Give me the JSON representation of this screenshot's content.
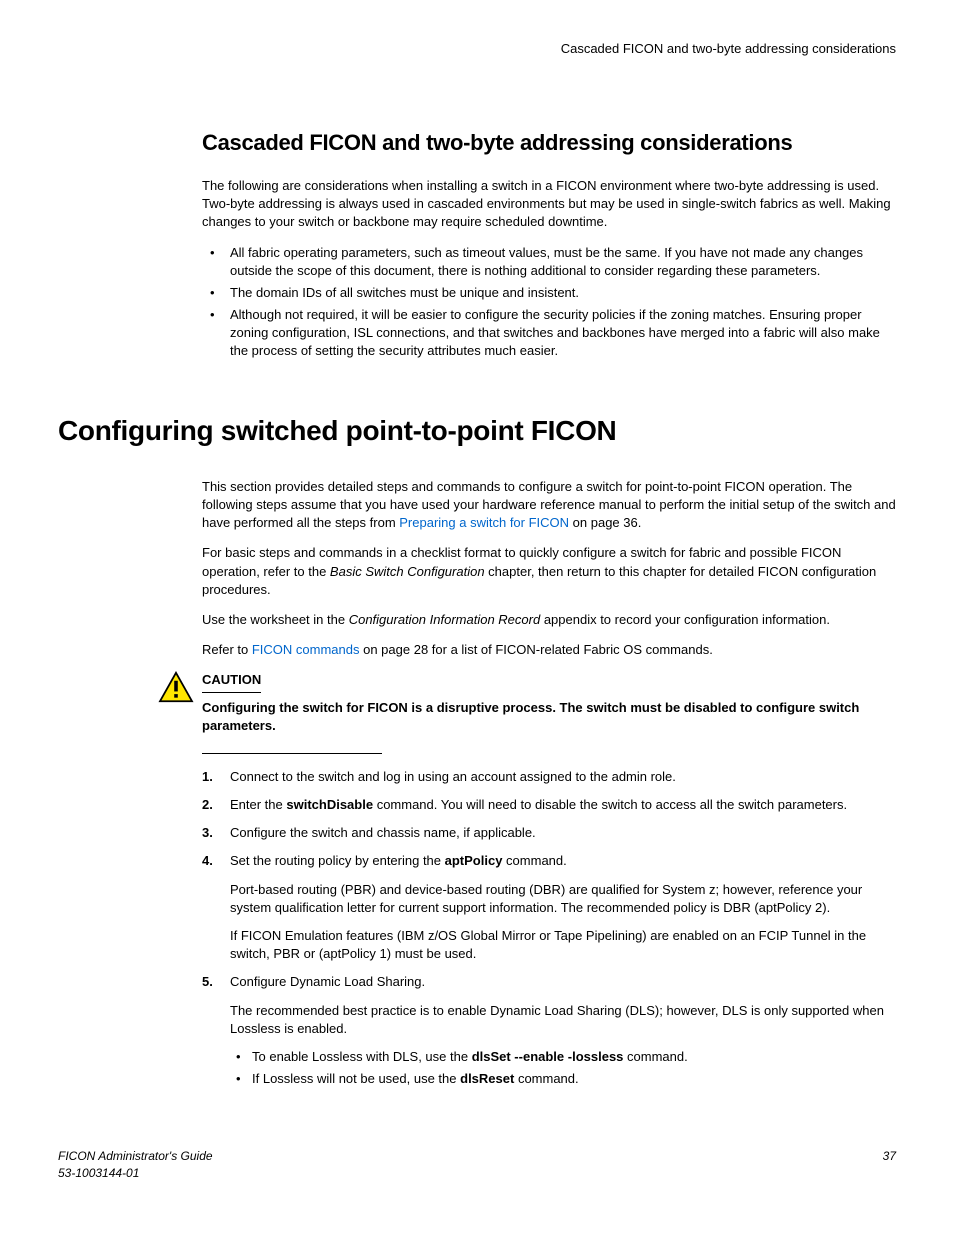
{
  "header": {
    "running": "Cascaded FICON and two-byte addressing considerations"
  },
  "section1": {
    "title": "Cascaded FICON and two-byte addressing considerations",
    "intro": "The following are considerations when installing a switch in a FICON environment where two-byte addressing is used. Two-byte addressing is always used in cascaded environments but may be used in single-switch fabrics as well. Making changes to your switch or backbone may require scheduled downtime.",
    "bullets": [
      "All fabric operating parameters, such as timeout values, must be the same. If you have not made any changes outside the scope of this document, there is nothing additional to consider regarding these parameters.",
      "The domain IDs of all switches must be unique and insistent.",
      "Although not required, it will be easier to configure the security policies if the zoning matches. Ensuring proper zoning configuration, ISL connections, and that switches and backbones have merged into a fabric will also make the process of setting the security attributes much easier."
    ]
  },
  "section2": {
    "title": "Configuring switched point-to-point FICON",
    "p1a": "This section provides detailed steps and commands to configure a switch for point-to-point FICON operation. The following steps assume that you have used your hardware reference manual to perform the initial setup of the switch and have performed all the steps from ",
    "p1link": "Preparing a switch for FICON",
    "p1b": " on page 36.",
    "p2a": "For basic steps and commands in a checklist format to quickly configure a switch for fabric and possible FICON operation, refer to the ",
    "p2italic": "Basic Switch Configuration",
    "p2b": " chapter, then return to this chapter for detailed FICON configuration procedures.",
    "p3a": "Use the worksheet in the ",
    "p3italic": "Configuration Information Record",
    "p3b": " appendix to record your configuration information.",
    "p4a": "Refer to ",
    "p4link": "FICON commands",
    "p4b": " on page 28 for a list of FICON-related Fabric OS commands.",
    "caution_label": "CAUTION",
    "caution_text": "Configuring the switch for FICON is a disruptive process. The switch must be disabled to configure switch parameters.",
    "steps": {
      "s1": "Connect to the switch and log in using an account assigned to the admin role.",
      "s2a": "Enter the ",
      "s2bold": "switchDisable",
      "s2b": " command. You will need to disable the switch to access all the switch parameters.",
      "s3": "Configure the switch and chassis name, if applicable.",
      "s4a": "Set the routing policy by entering the ",
      "s4bold": "aptPolicy",
      "s4b": " command.",
      "s4p1": "Port-based routing (PBR) and device-based routing (DBR) are qualified for System z; however, reference your system qualification letter for current support information. The recommended policy is DBR (aptPolicy 2).",
      "s4p2": "If FICON Emulation features (IBM z/OS Global Mirror or Tape Pipelining) are enabled on an FCIP Tunnel in the switch, PBR or (aptPolicy 1) must be used.",
      "s5": "Configure Dynamic Load Sharing.",
      "s5p1": "The recommended best practice is to enable Dynamic Load Sharing (DLS); however, DLS is only supported when Lossless is enabled.",
      "s5b1a": "To enable Lossless with DLS, use the ",
      "s5b1bold": "dlsSet --enable -lossless",
      "s5b1b": " command.",
      "s5b2a": "If Lossless will not be used, use the ",
      "s5b2bold": "dlsReset",
      "s5b2b": " command."
    }
  },
  "footer": {
    "left1": "FICON Administrator's Guide",
    "left2": "53-1003144-01",
    "right": "37"
  }
}
